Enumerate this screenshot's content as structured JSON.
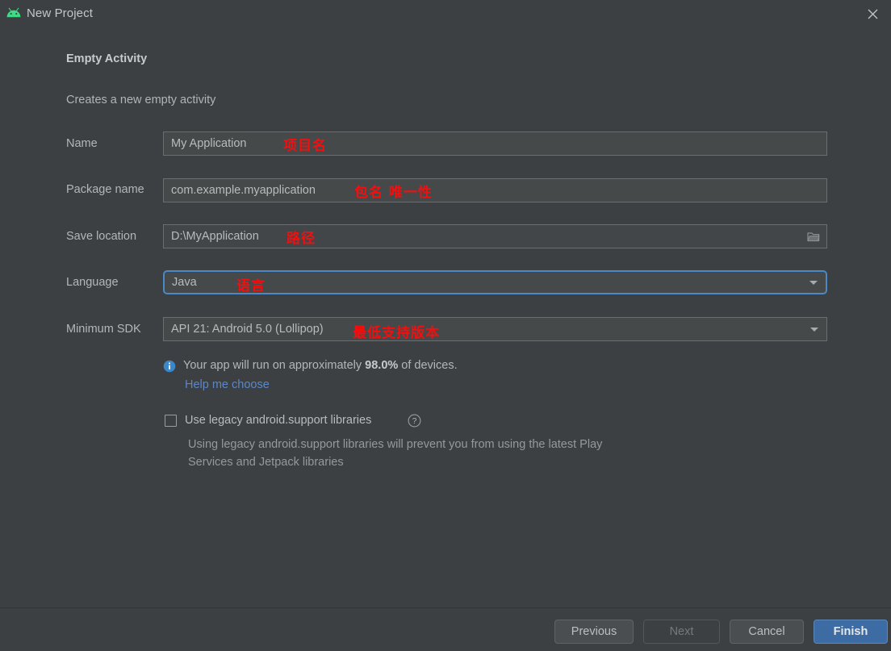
{
  "window": {
    "title": "New Project",
    "app_icon": "android-robot-icon",
    "close_icon": "close-icon"
  },
  "header": {
    "heading": "Empty Activity",
    "subheading": "Creates a new empty activity"
  },
  "form": {
    "rows": [
      {
        "label": "Name",
        "value": "My Application",
        "annotation": "项目名",
        "type": "text"
      },
      {
        "label": "Package name",
        "value": "com.example.myapplication",
        "annotation": "包名 唯一性",
        "type": "text"
      },
      {
        "label": "Save location",
        "value": "D:\\MyApplication",
        "annotation": "路径",
        "type": "path",
        "browse_icon": "folder-icon"
      },
      {
        "label": "Language",
        "value": "Java",
        "annotation": "语言",
        "type": "combo",
        "focused": true,
        "arrow_icon": "chevron-down-icon"
      },
      {
        "label": "Minimum SDK",
        "value": "API 21: Android 5.0 (Lollipop)",
        "annotation": "最低支持版本",
        "type": "combo",
        "focused": false,
        "arrow_icon": "chevron-down-icon"
      }
    ]
  },
  "sdk_info": {
    "icon": "info-icon",
    "text_prefix": "Your app will run on approximately ",
    "percentage": "98.0%",
    "text_suffix": " of devices.",
    "help_link": "Help me choose"
  },
  "legacy": {
    "checkbox_label": "Use legacy android.support libraries",
    "checked": false,
    "help_icon": "question-mark-icon",
    "description": "Using legacy android.support libraries will prevent you from using the latest Play Services and Jetpack libraries"
  },
  "buttons": {
    "previous": "Previous",
    "next": "Next",
    "next_disabled": true,
    "cancel": "Cancel",
    "finish": "Finish"
  },
  "colors": {
    "background": "#3c4042",
    "field_background": "#45494a",
    "accent_blue": "#3d6ba3",
    "link_blue": "#5b87c8",
    "focus_blue": "#4a88c7",
    "annotation_red": "#f01010",
    "android_green": "#3ddc84"
  }
}
